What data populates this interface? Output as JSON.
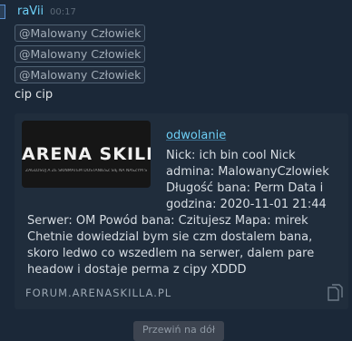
{
  "message": {
    "username": "raVii",
    "timestamp": "00:17",
    "mentions": [
      "@Malowany Człowiek",
      "@Malowany Człowiek",
      "@Malowany Człowiek"
    ],
    "text": "cip cip"
  },
  "embed": {
    "thumbnail_title": "ARENA SKILLA",
    "thumbnail_tagline": "ZAGLOSUJ A ZE SKINMATEM DOSTANIESZ SIĘ NA NASZYM SERWERZE",
    "title": "odwolanie",
    "description_lines": [
      "Nick: ich bin cool Nick",
      "admina: MalowanyCzlowiek",
      "Długość bana: Perm Data i",
      "godzina: 2020-11-01 21:44"
    ],
    "description_rest": "Serwer: OM Powód bana: Czitujesz Mapa: mirek Chetnie dowiedzial bym sie czm dostalem bana, skoro ledwo co wszedlem na serwer, dalem pare headow i dostaje perma z cipy XDDD",
    "url": "FORUM.ARENASKILLA.PL"
  },
  "scroll_button": "Przewiń na dół",
  "colors": {
    "background": "#1b2838",
    "username": "#6dcff6",
    "link": "#6dcff6",
    "embed_bg": "#202d3c"
  }
}
